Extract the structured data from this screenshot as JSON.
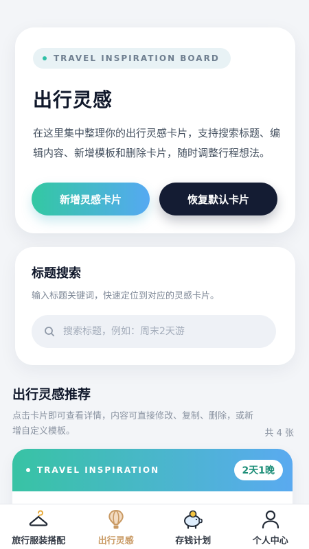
{
  "hero": {
    "pill": "TRAVEL INSPIRATION BOARD",
    "title": "出行灵感",
    "description": "在这里集中整理你的出行灵感卡片，支持搜索标题、编辑内容、新增模板和删除卡片，随时调整行程想法。",
    "add_button": "新增灵感卡片",
    "reset_button": "恢复默认卡片"
  },
  "search": {
    "title": "标题搜索",
    "description": "输入标题关键词，快速定位到对应的灵感卡片。",
    "placeholder": "搜索标题，例如：周末2天游",
    "value": ""
  },
  "recommend": {
    "title": "出行灵感推荐",
    "description": "点击卡片即可查看详情，内容可直接修改、复制、删除，或新增自定义模板。",
    "count": "共 4 张"
  },
  "cards": [
    {
      "label": "TRAVEL INSPIRATION",
      "badge": "2天1晚"
    }
  ],
  "tabbar": {
    "items": [
      {
        "label": "旅行服装搭配",
        "icon": "hanger-icon",
        "active": false
      },
      {
        "label": "出行灵感",
        "icon": "hot-air-balloon-icon",
        "active": true
      },
      {
        "label": "存钱计划",
        "icon": "piggy-bank-icon",
        "active": false
      },
      {
        "label": "个人中心",
        "icon": "user-icon",
        "active": false
      }
    ]
  },
  "colors": {
    "accent_start": "#33c8a2",
    "accent_end": "#55a9f2",
    "dark_button": "#141c33",
    "active_tab": "#c99a64"
  }
}
